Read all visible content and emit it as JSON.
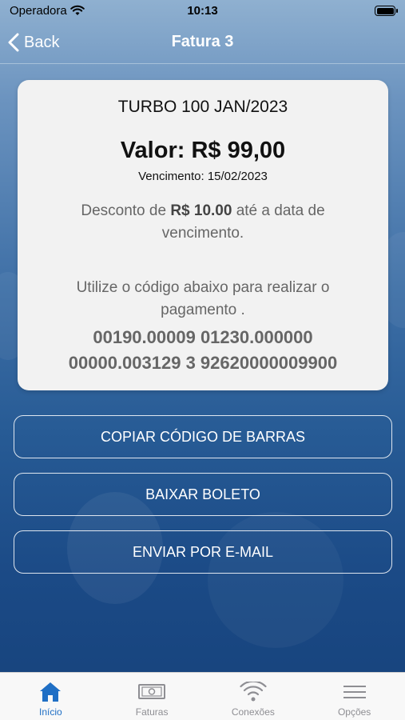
{
  "status_bar": {
    "carrier": "Operadora",
    "time": "10:13"
  },
  "nav": {
    "back_label": "Back",
    "title": "Fatura 3"
  },
  "invoice": {
    "plan": "TURBO 100 JAN/2023",
    "amount_prefix": "Valor: ",
    "amount": "R$ 99,00",
    "due_prefix": "Vencimento: ",
    "due_date": "15/02/2023",
    "discount_before": "Desconto de ",
    "discount_value": "R$ 10.00",
    "discount_after": " até a data de vencimento.",
    "instruction": "Utilize o código abaixo para realizar o pagamento .",
    "barcode_line1": "00190.00009 01230.000000",
    "barcode_line2": "00000.003129 3 92620000009900"
  },
  "actions": {
    "copy_label": "COPIAR CÓDIGO DE BARRAS",
    "download_label": "BAIXAR BOLETO",
    "email_label": "ENVIAR POR E-MAIL"
  },
  "tabs": [
    {
      "label": "Início",
      "icon": "home-icon",
      "active": true
    },
    {
      "label": "Faturas",
      "icon": "invoice-icon",
      "active": false
    },
    {
      "label": "Conexões",
      "icon": "wifi-icon",
      "active": false
    },
    {
      "label": "Opções",
      "icon": "menu-icon",
      "active": false
    }
  ],
  "colors": {
    "accent": "#1f6fc5",
    "inactive": "#8e8e93"
  }
}
